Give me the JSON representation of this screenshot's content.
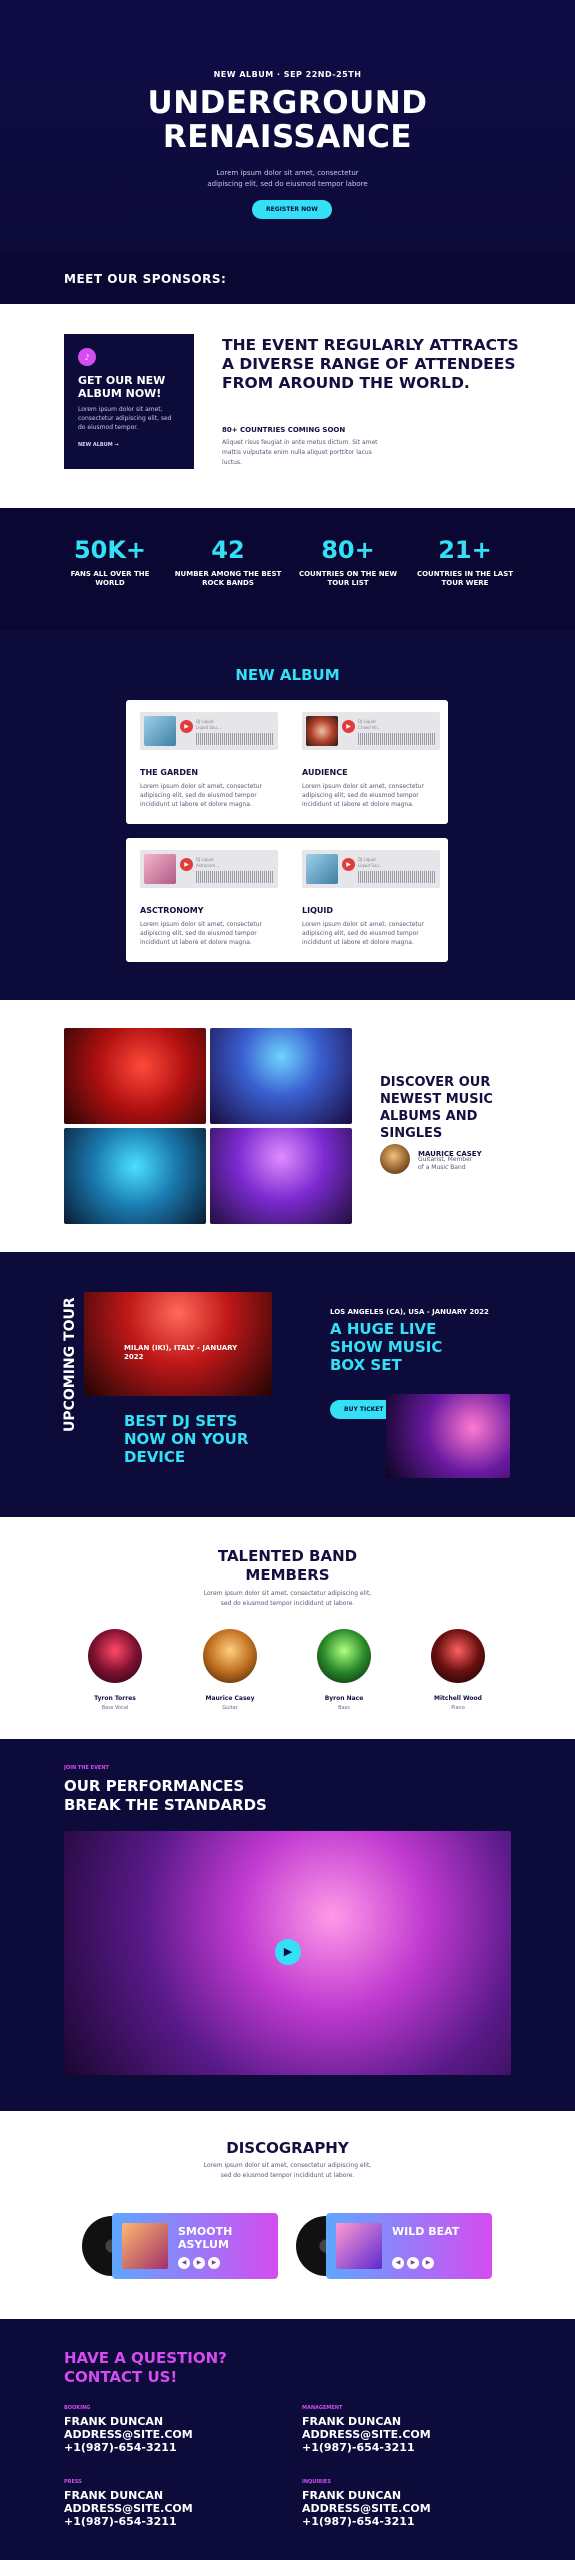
{
  "hero": {
    "eyebrow": "NEW ALBUM · SEP 22ND-25TH",
    "title_line1": "UNDERGROUND",
    "title_line2": "RENAISSANCE",
    "sub_line1": "Lorem ipsum dolor sit amet, consectetur",
    "sub_line2": "adipiscing elit, sed do eiusmod tempor labore",
    "button": "REGISTER NOW"
  },
  "sponsors": {
    "title": "MEET OUR SPONSORS:"
  },
  "event": {
    "card": {
      "icon": "music-note-icon",
      "title": "GET OUR NEW ALBUM NOW!",
      "desc": "Lorem ipsum dolor sit amet, consectetur adipiscing elit, sed do eiusmod tempor.",
      "link": "NEW ALBUM →"
    },
    "heading": "THE EVENT REGULARLY ATTRACTS A DIVERSE RANGE OF ATTENDEES FROM AROUND THE WORLD.",
    "count": "80+ COUNTRIES COMING SOON",
    "desc": "Aliquet risus feugiat in ante metus dictum. Sit amet mattis vulputate enim nulla aliquet porttitor lacus luctus."
  },
  "stats": [
    {
      "n": "50K+",
      "l": "FANS ALL OVER THE WORLD"
    },
    {
      "n": "42",
      "l": "NUMBER AMONG THE BEST ROCK BANDS"
    },
    {
      "n": "80+",
      "l": "COUNTRIES ON THE NEW TOUR LIST"
    },
    {
      "n": "21+",
      "l": "COUNTRIES IN THE LAST TOUR WERE"
    }
  ],
  "album": {
    "title": "NEW ALBUM",
    "tracks": [
      {
        "name": "THE GARDEN",
        "desc": "Lorem ipsum dolor sit amet, consectetur adipiscing elit, sed do eiusmod tempor incididunt ut labore et dolore magna.",
        "meta1": "DJ Liquid",
        "meta2": "Liquid Sou..."
      },
      {
        "name": "AUDIENCE",
        "desc": "Lorem ipsum dolor sit amet, consectetur adipiscing elit, sed do eiusmod tempor incididunt ut labore et dolore magna.",
        "meta1": "DJ Liquid",
        "meta2": "Crowd Ve..."
      },
      {
        "name": "ASCTRONOMY",
        "desc": "Lorem ipsum dolor sit amet, consectetur adipiscing elit, sed do eiusmod tempor incididunt ut labore et dolore magna.",
        "meta1": "DJ Liquid",
        "meta2": "Astronom..."
      },
      {
        "name": "LIQUID",
        "desc": "Lorem ipsum dolor sit amet, consectetur adipiscing elit, sed do eiusmod tempor incididunt ut labore et dolore magna.",
        "meta1": "DJ Liquid",
        "meta2": "Liquid Sou..."
      }
    ]
  },
  "discover": {
    "title": "DISCOVER OUR NEWEST MUSIC ALBUMS AND SINGLES",
    "author": "MAURICE CASEY",
    "role_line1": "Guitarist, Member",
    "role_line2": "of a Music Band"
  },
  "tour": {
    "vertical": "UPCOMING TOUR",
    "cap1_line1": "MILAN (IKI), ITALY - JANUARY",
    "cap1_line2": "2022",
    "title1": "BEST DJ SETS NOW ON YOUR DEVICE",
    "cap2": "LOS ANGELES (CA), USA - JANUARY 2022",
    "title2": "A HUGE LIVE SHOW MUSIC BOX SET",
    "button": "BUY TICKET"
  },
  "band": {
    "title_line1": "TALENTED BAND",
    "title_line2": "MEMBERS",
    "sub_line1": "Lorem ipsum dolor sit amet, consectetur adipiscing elit,",
    "sub_line2": "sed do eiusmod tempor incididunt ut labore.",
    "members": [
      {
        "name": "Tyron Torres",
        "role": "Bass Vocal"
      },
      {
        "name": "Maurice Casey",
        "role": "Guitar"
      },
      {
        "name": "Byron Nace",
        "role": "Bass"
      },
      {
        "name": "Mitchell Wood",
        "role": "Piano"
      }
    ]
  },
  "perf": {
    "eyebrow": "JOIN THE EVENT",
    "title_line1": "OUR PERFORMANCES",
    "title_line2": "BREAK THE STANDARDS"
  },
  "disco": {
    "title": "DISCOGRAPHY",
    "sub_line1": "Lorem ipsum dolor sit amet, consectetur adipiscing elit,",
    "sub_line2": "sed do eiusmod tempor incididunt ut labore.",
    "records": [
      {
        "name_line1": "SMOOTH",
        "name_line2": "ASYLUM"
      },
      {
        "name_line1": "WILD BEAT",
        "name_line2": ""
      }
    ]
  },
  "contact": {
    "title_line1": "HAVE A QUESTION?",
    "title_line2": "CONTACT US!",
    "blocks": [
      {
        "label": "BOOKING",
        "name": "FRANK DUNCAN",
        "email": "ADDRESS@SITE.COM",
        "phone": "+1(987)-654-3211"
      },
      {
        "label": "MANAGEMENT",
        "name": "FRANK DUNCAN",
        "email": "ADDRESS@SITE.COM",
        "phone": "+1(987)-654-3211"
      },
      {
        "label": "PRESS",
        "name": "FRANK DUNCAN",
        "email": "ADDRESS@SITE.COM",
        "phone": "+1(987)-654-3211"
      },
      {
        "label": "INQUIRIES",
        "name": "FRANK DUNCAN",
        "email": "ADDRESS@SITE.COM",
        "phone": "+1(987)-654-3211"
      }
    ]
  },
  "colors": {
    "navy": "#0d0b3a",
    "cyan": "#34e0f5",
    "magenta": "#d54cf0"
  }
}
